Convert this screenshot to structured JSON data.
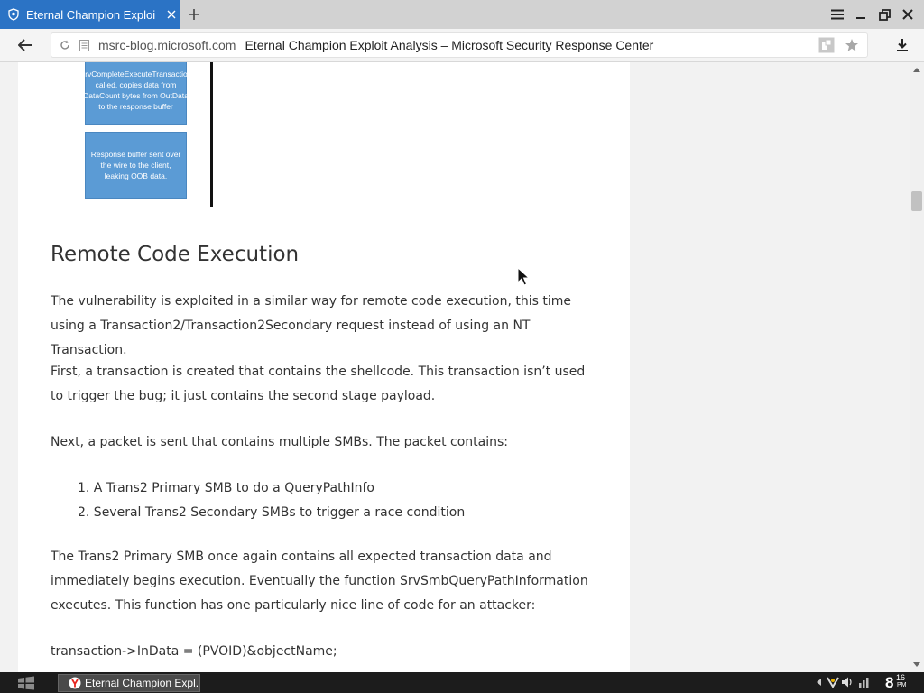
{
  "browser": {
    "tab_title": "Eternal Champion Exploit Analysis – Microsoft Security Response Center",
    "tab_title_short": "Eternal Champion Exploi",
    "url_domain": "msrc-blog.microsoft.com",
    "page_title": "Eternal Champion Exploit Analysis – Microsoft Security Response Center",
    "accent_color": "#2b73c5"
  },
  "flowchart": {
    "box1": "SrvCompleteExecuteTransaction called, copies data from DataCount bytes from OutData to the response buffer",
    "box2": "Response buffer sent over the wire to the client, leaking OOB data."
  },
  "article": {
    "heading": "Remote Code Execution",
    "p1": "The vulnerability is exploited in a similar way for remote code execution, this time using a Transaction2/Transaction2Secondary request instead of using an NT Transaction.",
    "p2": "First, a transaction is created that contains the shellcode. This transaction isn’t used to trigger the bug; it just contains the second stage payload.",
    "p3": "Next, a packet is sent that contains multiple SMBs. The packet contains:",
    "list": [
      "1. A Trans2 Primary SMB to do a QueryPathInfo",
      "2. Several Trans2 Secondary SMBs to trigger a race condition"
    ],
    "p4": "The Trans2 Primary SMB once again contains all expected transaction data and immediately begins execution. Eventually the function SrvSmbQueryPathInformation executes. This function has one particularly nice line of code for an attacker:",
    "code_line": "transaction->InData = (PVOID)&objectName;"
  },
  "taskbar": {
    "item_label": "Eternal Champion Expl...",
    "clock_hour": "8",
    "clock_min": "16",
    "clock_ampm": "PM"
  }
}
